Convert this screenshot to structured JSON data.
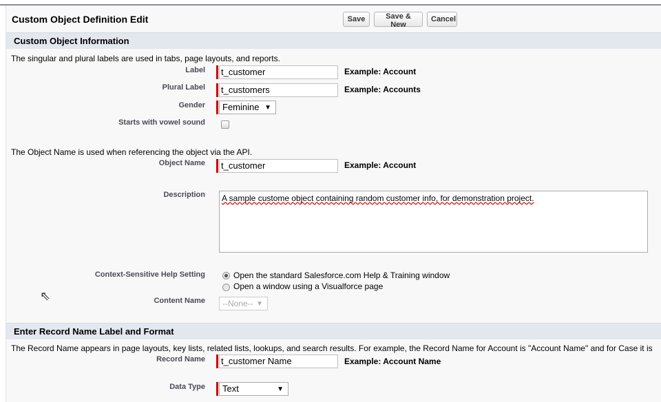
{
  "header": {
    "title": "Custom Object Definition Edit",
    "buttons": {
      "save": "Save",
      "save_new": "Save & New",
      "cancel": "Cancel"
    }
  },
  "section1": {
    "title": "Custom Object Information",
    "intro1": "The singular and plural labels are used in tabs, page layouts, and reports.",
    "label": {
      "label": "Label",
      "value": "t_customer",
      "example": "Example:  Account"
    },
    "plural": {
      "label": "Plural Label",
      "value": "t_customers",
      "example": "Example:  Accounts"
    },
    "gender": {
      "label": "Gender",
      "value": "Feminine"
    },
    "vowel": {
      "label": "Starts with vowel sound",
      "checked": false
    },
    "intro2": "The Object Name is used when referencing the object via the API.",
    "object_name": {
      "label": "Object Name",
      "value": "t_customer",
      "example": "Example:  Account"
    },
    "description": {
      "label": "Description",
      "value": "A sample custome object containing random customer info, for demonstration project."
    },
    "help": {
      "label": "Context-Sensitive Help Setting",
      "options": [
        "Open the standard Salesforce.com Help & Training window",
        "Open a window using a Visualforce page"
      ],
      "selected": 0
    },
    "content_name": {
      "label": "Content Name",
      "value": "--None--"
    }
  },
  "section2": {
    "title": "Enter Record Name Label and Format",
    "intro": "The Record Name appears in page layouts, key lists, related lists, lookups, and search results. For example, the Record Name for Account is \"Account Name\" and for Case it is",
    "record_name": {
      "label": "Record Name",
      "value": "t_customer Name",
      "example": "Example:  Account Name"
    },
    "data_type": {
      "label": "Data Type",
      "value": "Text"
    }
  },
  "colors": {
    "required": "#cc0000",
    "section_bg": "#e3e7ee"
  }
}
